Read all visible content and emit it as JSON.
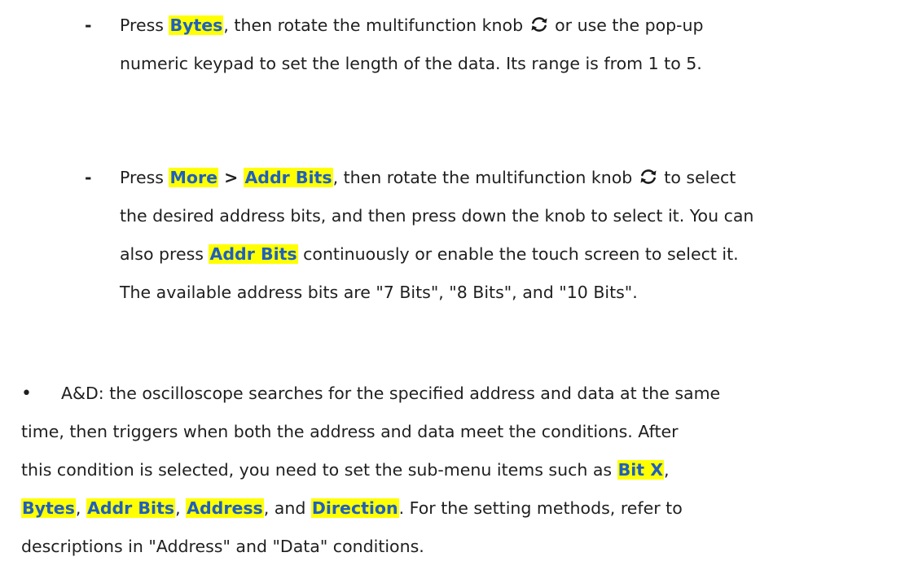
{
  "doc": {
    "sub_marker": "-",
    "bullet_marker": "•",
    "knob_icon": "rotate-knob-icon",
    "sub1": {
      "t1": "Press ",
      "k1": "Bytes",
      "t2": ", then rotate the multifunction knob ",
      "t3": " or use the pop-up",
      "t4": "numeric keypad to set the length of the data. Its range is from 1 to 5."
    },
    "sub2": {
      "t1": "Press ",
      "k1": "More",
      "t2": " > ",
      "k2": "Addr Bits",
      "t3": ", then rotate the multifunction knob ",
      "t4": " to select",
      "t5": "the desired address bits, and then press down the knob to select it. You can",
      "t6": "also press ",
      "k3": "Addr Bits",
      "t7": " continuously or enable the touch screen to select it.",
      "t8": "The available address bits are \"7 Bits\", \"8 Bits\", and \"10 Bits\"."
    },
    "main1": {
      "t1": "A&D: the oscilloscope searches for the specified address and data at the same",
      "t2": "time, then triggers when both the address and data meet the conditions. After",
      "t3": "this condition is selected, you need to set the sub-menu items such as ",
      "k1": "Bit X",
      "t4": ",",
      "k2": "Bytes",
      "t5": ", ",
      "k3": "Addr Bits",
      "t6": ", ",
      "k4": "Address",
      "t7": ", and ",
      "k5": "Direction",
      "t8": ". For the setting methods, refer to",
      "t9": "descriptions in \"Address\" and \"Data\" conditions."
    }
  }
}
